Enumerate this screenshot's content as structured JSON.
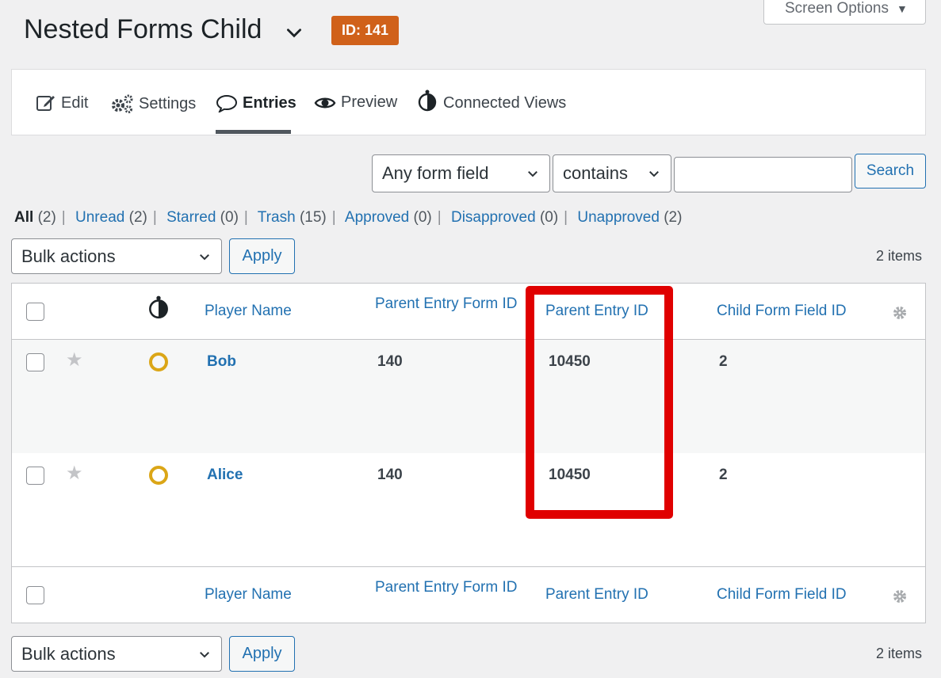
{
  "page": {
    "title": "Nested Forms Child",
    "form_id_badge": "ID: 141",
    "screen_options": "Screen Options"
  },
  "toolbar": {
    "items": [
      {
        "label": "Edit",
        "icon": "edit-icon"
      },
      {
        "label": "Settings",
        "icon": "settings-gears-icon"
      },
      {
        "label": "Entries",
        "icon": "entries-speech-bubble-icon",
        "active": true
      },
      {
        "label": "Preview",
        "icon": "eye-icon"
      },
      {
        "label": "Connected Views",
        "icon": "gravityview-icon"
      }
    ]
  },
  "search": {
    "field_select": "Any form field",
    "operator_select": "contains",
    "value": "",
    "button": "Search"
  },
  "filters": [
    {
      "label": "All",
      "count": "(2)",
      "current": true
    },
    {
      "label": "Unread",
      "count": "(2)"
    },
    {
      "label": "Starred",
      "count": "(0)"
    },
    {
      "label": "Trash",
      "count": "(15)"
    },
    {
      "label": "Approved",
      "count": "(0)"
    },
    {
      "label": "Disapproved",
      "count": "(0)"
    },
    {
      "label": "Unapproved",
      "count": "(2)"
    }
  ],
  "bulk": {
    "select": "Bulk actions",
    "apply": "Apply",
    "items_count": "2 items"
  },
  "table": {
    "columns": [
      "Player Name",
      "Parent Entry Form ID",
      "Parent Entry ID",
      "Child Form Field ID"
    ],
    "rows": [
      {
        "player_name": "Bob",
        "parent_form_id": "140",
        "parent_entry_id": "10450",
        "child_field_id": "2"
      },
      {
        "player_name": "Alice",
        "parent_form_id": "140",
        "parent_entry_id": "10450",
        "child_field_id": "2"
      }
    ]
  },
  "colors": {
    "accent": "#2271b1",
    "badge": "#d0611a",
    "highlight": "#e00000",
    "unread": "#dba617"
  }
}
